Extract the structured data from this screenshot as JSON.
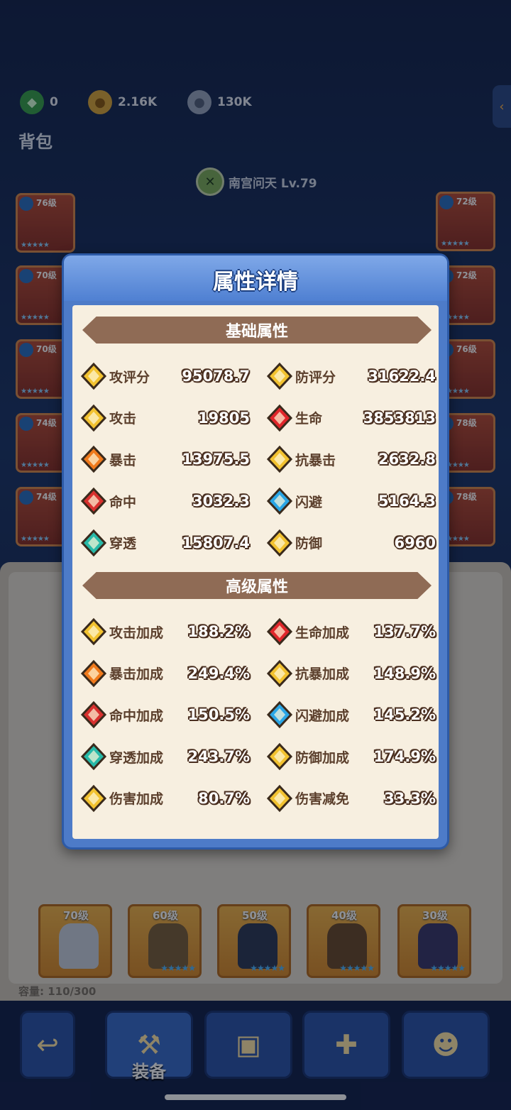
{
  "resources": [
    {
      "icon": "green-gem-icon",
      "value": "0"
    },
    {
      "icon": "gold-coin-icon",
      "value": "2.16K"
    },
    {
      "icon": "silver-coin-icon",
      "value": "130K"
    }
  ],
  "bag_title": "背包",
  "hero": {
    "name": "南宫问天 Lv.79"
  },
  "equipped_left": [
    {
      "level": "76级"
    },
    {
      "level": "70级"
    },
    {
      "level": "70级"
    },
    {
      "level": "74级"
    },
    {
      "level": "74级"
    }
  ],
  "equipped_right": [
    {
      "level": "72级"
    },
    {
      "level": "72级"
    },
    {
      "level": "76级"
    },
    {
      "level": "78级"
    },
    {
      "level": "78级"
    }
  ],
  "bag_items": [
    {
      "level": "70级"
    },
    {
      "level": "60级"
    },
    {
      "level": "50级"
    },
    {
      "level": "40级"
    },
    {
      "level": "30级"
    }
  ],
  "capacity": "容量: 110/300",
  "nav": {
    "equip_label": "装备"
  },
  "modal": {
    "title": "属性详情",
    "basic_title": "基础属性",
    "advanced_title": "高级属性",
    "basic": [
      {
        "name": "攻评分",
        "value": "95078.7",
        "icon": "attack-rating-icon",
        "color": "#f2c230"
      },
      {
        "name": "防评分",
        "value": "31622.4",
        "icon": "defense-rating-icon",
        "color": "#f2c230"
      },
      {
        "name": "攻击",
        "value": "19805",
        "icon": "attack-icon",
        "color": "#f2c230"
      },
      {
        "name": "生命",
        "value": "3853813",
        "icon": "heart-icon",
        "color": "#e0262b"
      },
      {
        "name": "暴击",
        "value": "13975.5",
        "icon": "crit-icon",
        "color": "#f07a1c"
      },
      {
        "name": "抗暴击",
        "value": "2632.8",
        "icon": "crit-resist-icon",
        "color": "#f2c230"
      },
      {
        "name": "命中",
        "value": "3032.3",
        "icon": "hit-icon",
        "color": "#d8302e"
      },
      {
        "name": "闪避",
        "value": "5164.3",
        "icon": "dodge-icon",
        "color": "#2aa6e6"
      },
      {
        "name": "穿透",
        "value": "15807.4",
        "icon": "pierce-icon",
        "color": "#27b9a8"
      },
      {
        "name": "防御",
        "value": "6960",
        "icon": "shield-icon",
        "color": "#f2c230"
      }
    ],
    "advanced": [
      {
        "name": "攻击加成",
        "value": "188.2%",
        "icon": "attack-bonus-icon",
        "color": "#f2c230"
      },
      {
        "name": "生命加成",
        "value": "137.7%",
        "icon": "heart-bonus-icon",
        "color": "#e0262b"
      },
      {
        "name": "暴击加成",
        "value": "249.4%",
        "icon": "crit-bonus-icon",
        "color": "#f07a1c"
      },
      {
        "name": "抗暴加成",
        "value": "148.9%",
        "icon": "crit-resist-bonus-icon",
        "color": "#f2c230"
      },
      {
        "name": "命中加成",
        "value": "150.5%",
        "icon": "hit-bonus-icon",
        "color": "#d8302e"
      },
      {
        "name": "闪避加成",
        "value": "145.2%",
        "icon": "dodge-bonus-icon",
        "color": "#2aa6e6"
      },
      {
        "name": "穿透加成",
        "value": "243.7%",
        "icon": "pierce-bonus-icon",
        "color": "#27b9a8"
      },
      {
        "name": "防御加成",
        "value": "174.9%",
        "icon": "defense-bonus-icon",
        "color": "#f2c230"
      },
      {
        "name": "伤害加成",
        "value": "80.7%",
        "icon": "damage-bonus-icon",
        "color": "#f2c230"
      },
      {
        "name": "伤害减免",
        "value": "33.3%",
        "icon": "damage-reduction-icon",
        "color": "#f2c230"
      }
    ]
  }
}
